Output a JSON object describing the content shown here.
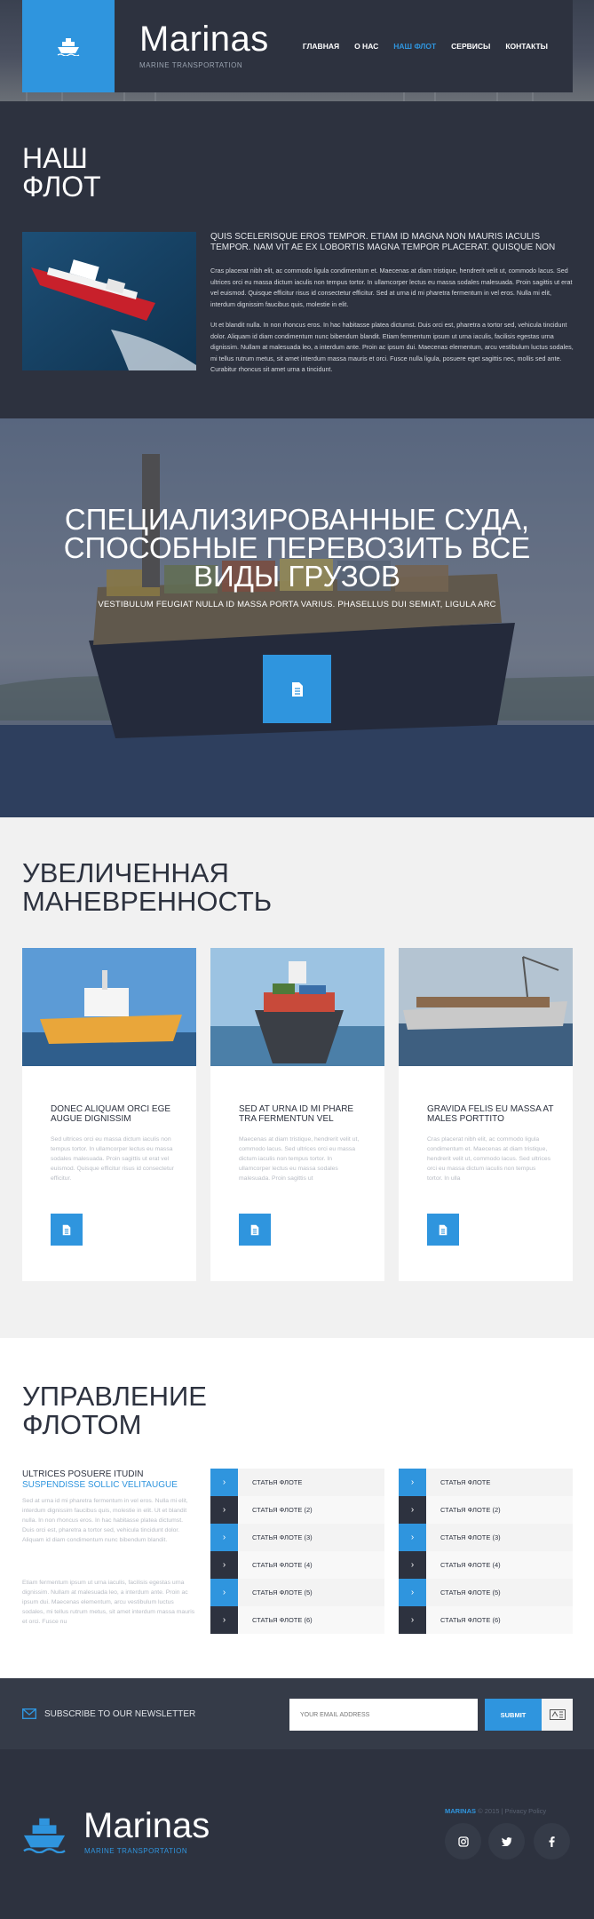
{
  "header": {
    "brand_name": "Marinas",
    "brand_tagline": "MARINE TRANSPORTATION",
    "nav": [
      "ГЛАВНАЯ",
      "О НАС",
      "НАШ ФЛОТ",
      "СЕРВИСЫ",
      "КОНТАКТЫ"
    ],
    "active_nav": "НАШ ФЛОТ",
    "accent_color": "#2f95de",
    "dark_color": "#2d323f"
  },
  "fleet": {
    "heading_line1": "НАШ",
    "heading_line2": "ФЛОТ",
    "lead": "QUIS SCELERISQUE EROS TEMPOR. ETIAM ID MAGNA NON MAURIS IACULIS TEMPOR. NAM VIT AE EX LOBORTIS MAGNA TEMPOR PLACERAT. QUISQUE NON",
    "paragraph1": "Cras placerat nibh elit, ac commodo ligula condimentum et. Maecenas at diam tristique, hendrerit velit ut, commodo lacus. Sed ultrices orci eu massa dictum iaculis non tempus tortor. In ullamcorper lectus eu massa sodales malesuada. Proin sagittis ut erat vel euismod. Quisque efficitur risus id consectetur efficitur. Sed at urna id mi pharetra fermentum in vel eros. Nulla mi elit, interdum dignissim faucibus quis, molestie in elit.",
    "paragraph2": "Ut et blandit nulla. In non rhoncus eros. In hac habitasse platea dictumst. Duis orci est, pharetra a tortor sed, vehicula tincidunt dolor. Aliquam id diam condimentum nunc bibendum blandit. Etiam fermentum ipsum ut urna iaculis, facilisis egestas urna dignissim. Nullam at malesuada leo, a interdum ante. Proin ac ipsum dui. Maecenas elementum, arcu vestibulum luctus sodales, mi tellus rutrum metus, sit amet interdum massa mauris et orci. Fusce nulla ligula, posuere eget sagittis nec, mollis sed ante. Curabitur rhoncus sit amet urna a tincidunt."
  },
  "hero": {
    "heading": "СПЕЦИАЛИЗИРОВАННЫЕ СУДА, СПОСОБНЫЕ ПЕРЕВОЗИТЬ ВСЕ ВИДЫ ГРУЗОВ",
    "subheading": "VESTIBULUM FEUGIAT NULLA ID MASSA PORTA VARIUS. PHASELLUS DUI SEMIAT, LIGULA ARC",
    "button_icon": "document-icon"
  },
  "maneuver": {
    "heading_line1": "УВЕЛИЧЕННАЯ",
    "heading_line2": "МАНЕВРЕННОСТЬ",
    "cards": [
      {
        "title": "DONEC ALIQUAM ORCI EGE AUGUE DIGNISSIM",
        "text": "Sed ultrices orci eu massa dictum iaculis non tempus tortor. In ullamcorper lectus eu massa sodales malesuada. Proin sagittis ut erat vel euismod. Quisque efficitur risus id consectetur efficitur."
      },
      {
        "title": "SED AT URNA ID MI PHARE TRA FERMENTUN VEL",
        "text": "Maecenas at diam tristique, hendrerit velit ut, commodo lacus. Sed ultrices orci eu massa dictum iaculis non tempus tortor. In ullamcorper lectus eu massa sodales malesuada. Proin sagittis ut"
      },
      {
        "title": "GRAVIDA FELIS EU MASSA AT MALES PORTTITO",
        "text": "Cras placerat nibh elit, ac commodo ligula condimentum et. Maecenas at diam tristique, hendrerit velit ut, commodo lacus. Sed ultrices orci eu massa dictum iaculis non tempus tortor. In ulla"
      }
    ]
  },
  "manage": {
    "heading_line1": "УПРАВЛЕНИЕ",
    "heading_line2": "ФЛОТОМ",
    "kicker1": "ULTRICES POSUERE ITUDIN",
    "kicker2": "SUSPENDISSE SOLLIC VELITAUGUE",
    "paragraph1": "Sed at urna id mi pharetra fermentum in vel eros. Nulla mi elit, interdum dignissim faucibus quis, molestie in elit. Ut et blandit nulla. In non rhoncus eros. In hac habitasse platea dictumst. Duis orci est, pharetra a tortor sed, vehicula tincidunt dolor. Aliquam id diam condimentum nunc bibendum blandit.",
    "paragraph2": "Etiam fermentum ipsum ut urna iaculis, facilisis egestas urna dignissim. Nullam at malesuada leo, a interdum ante. Proin ac ipsum dui. Maecenas elementum, arcu vestibulum luctus sodales, mi tellus rutrum metus, sit amet interdum massa mauris et orci. Fusce nu",
    "list_a": [
      "СТАТЬЯ ФЛОТЕ",
      "СТАТЬЯ ФЛОТЕ (2)",
      "СТАТЬЯ ФЛОТЕ (3)",
      "СТАТЬЯ ФЛОТЕ (4)",
      "СТАТЬЯ ФЛОТЕ (5)",
      "СТАТЬЯ ФЛОТЕ (6)"
    ],
    "list_b": [
      "СТАТЬЯ ФЛОТЕ",
      "СТАТЬЯ ФЛОТЕ (2)",
      "СТАТЬЯ ФЛОТЕ (3)",
      "СТАТЬЯ ФЛОТЕ (4)",
      "СТАТЬЯ ФЛОТЕ (5)",
      "СТАТЬЯ ФЛОТЕ (6)"
    ],
    "arrow": "›"
  },
  "newsletter": {
    "label": "SUBSCRIBE TO OUR NEWSLETTER",
    "email_placeholder": "YOUR EMAIL ADDRESS",
    "submit_label": "SUBMIT"
  },
  "footer": {
    "brand_name": "Marinas",
    "brand_tagline": "MARINE TRANSPORTATION",
    "copyright_brand": "MARINAS",
    "copyright_rest": "© 2015 | Privacy Policy",
    "social": [
      "instagram-icon",
      "twitter-icon",
      "facebook-icon"
    ]
  }
}
